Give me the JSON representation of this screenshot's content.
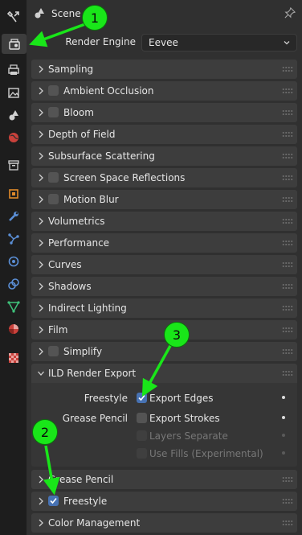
{
  "header": {
    "title": "Scene"
  },
  "render_engine": {
    "label": "Render Engine",
    "value": "Eevee"
  },
  "panels": [
    {
      "label": "Sampling"
    },
    {
      "label": "Ambient Occlusion"
    },
    {
      "label": "Bloom"
    },
    {
      "label": "Depth of Field"
    },
    {
      "label": "Subsurface Scattering"
    },
    {
      "label": "Screen Space Reflections"
    },
    {
      "label": "Motion Blur"
    },
    {
      "label": "Volumetrics"
    },
    {
      "label": "Performance"
    },
    {
      "label": "Curves"
    },
    {
      "label": "Shadows"
    },
    {
      "label": "Indirect Lighting"
    },
    {
      "label": "Film"
    },
    {
      "label": "Simplify"
    },
    {
      "label": "ILD Render Export"
    },
    {
      "label": "Grease Pencil"
    },
    {
      "label": "Freestyle"
    },
    {
      "label": "Color Management"
    }
  ],
  "ild": {
    "freestyle_label": "Freestyle",
    "export_edges": "Export Edges",
    "grease_pencil_label": "Grease Pencil",
    "export_strokes": "Export Strokes",
    "layers_separate": "Layers Separate",
    "use_fills": "Use Fills (Experimental)"
  },
  "annotations": {
    "badge1": "1",
    "badge2": "2",
    "badge3": "3"
  },
  "colors": {
    "accent": "#4772b3",
    "annotation": "#19e619"
  }
}
